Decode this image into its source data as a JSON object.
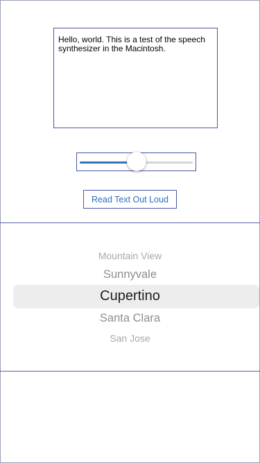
{
  "text_view": {
    "content": "Hello, world. This is a test of the speech synthesizer in the Macintosh."
  },
  "slider": {
    "value": 0.5,
    "fill_color": "#3a6fc0",
    "track_color": "#d5d5d9"
  },
  "read_button": {
    "label": "Read Text Out Loud"
  },
  "picker": {
    "items": [
      "Mountain View",
      "Sunnyvale",
      "Cupertino",
      "Santa Clara",
      "San Jose"
    ],
    "selected": "Cupertino"
  },
  "colors": {
    "accent": "#2a6cc7",
    "border": "#4a56a6"
  }
}
